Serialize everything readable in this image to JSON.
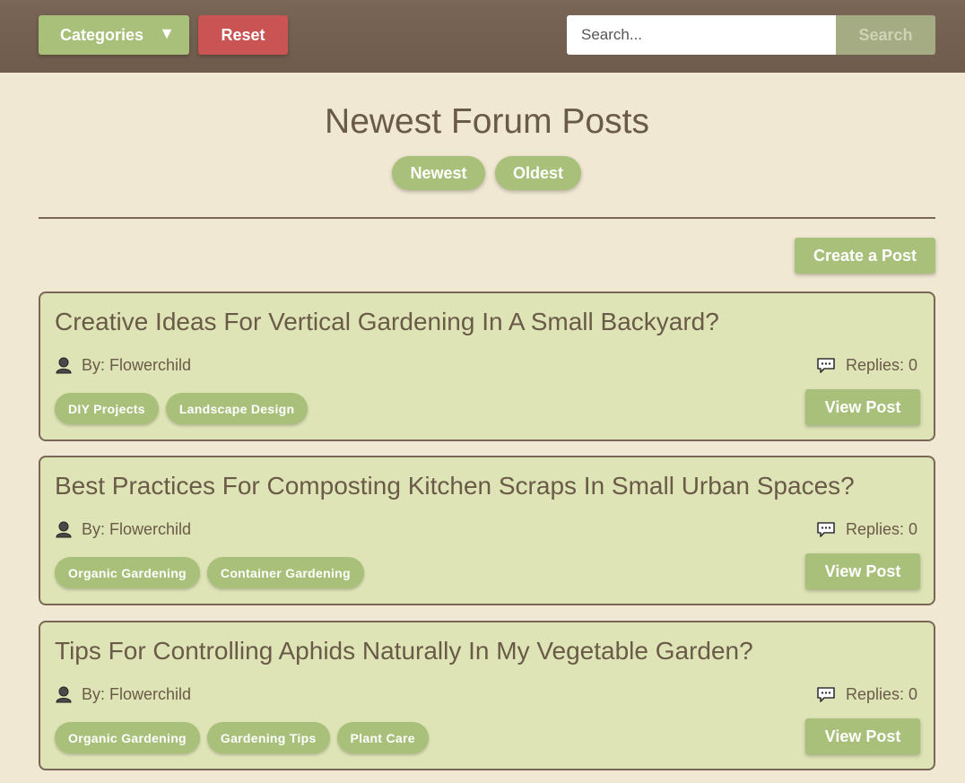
{
  "topbar": {
    "categories_label": "Categories",
    "categories_caret": "▼",
    "reset_label": "Reset",
    "search_placeholder": "Search...",
    "search_button": "Search"
  },
  "main": {
    "title": "Newest Forum Posts",
    "sort": {
      "newest": "Newest",
      "oldest": "Oldest"
    },
    "create_label": "Create a Post"
  },
  "posts": [
    {
      "title": "Creative Ideas For Vertical Gardening In A Small Backyard?",
      "author": "By: Flowerchild",
      "replies": "Replies: 0",
      "tags": [
        "DIY Projects",
        "Landscape Design"
      ],
      "view_label": "View Post"
    },
    {
      "title": "Best Practices For Composting Kitchen Scraps In Small Urban Spaces?",
      "author": "By: Flowerchild",
      "replies": "Replies: 0",
      "tags": [
        "Organic Gardening",
        "Container Gardening"
      ],
      "view_label": "View Post"
    },
    {
      "title": "Tips For Controlling Aphids Naturally In My Vegetable Garden?",
      "author": "By: Flowerchild",
      "replies": "Replies: 0",
      "tags": [
        "Organic Gardening",
        "Gardening Tips",
        "Plant Care"
      ],
      "view_label": "View Post"
    }
  ],
  "colors": {
    "topbar": "#735f4f",
    "background": "#f0e8d2",
    "accent_green": "#a9c07a",
    "reset_red": "#c95453",
    "card_bg": "#dfe4b6",
    "text_brown": "#6a5a48"
  },
  "icons": {
    "author": "person-icon",
    "replies": "speech-bubble-icon",
    "categories": "caret-down-icon"
  }
}
